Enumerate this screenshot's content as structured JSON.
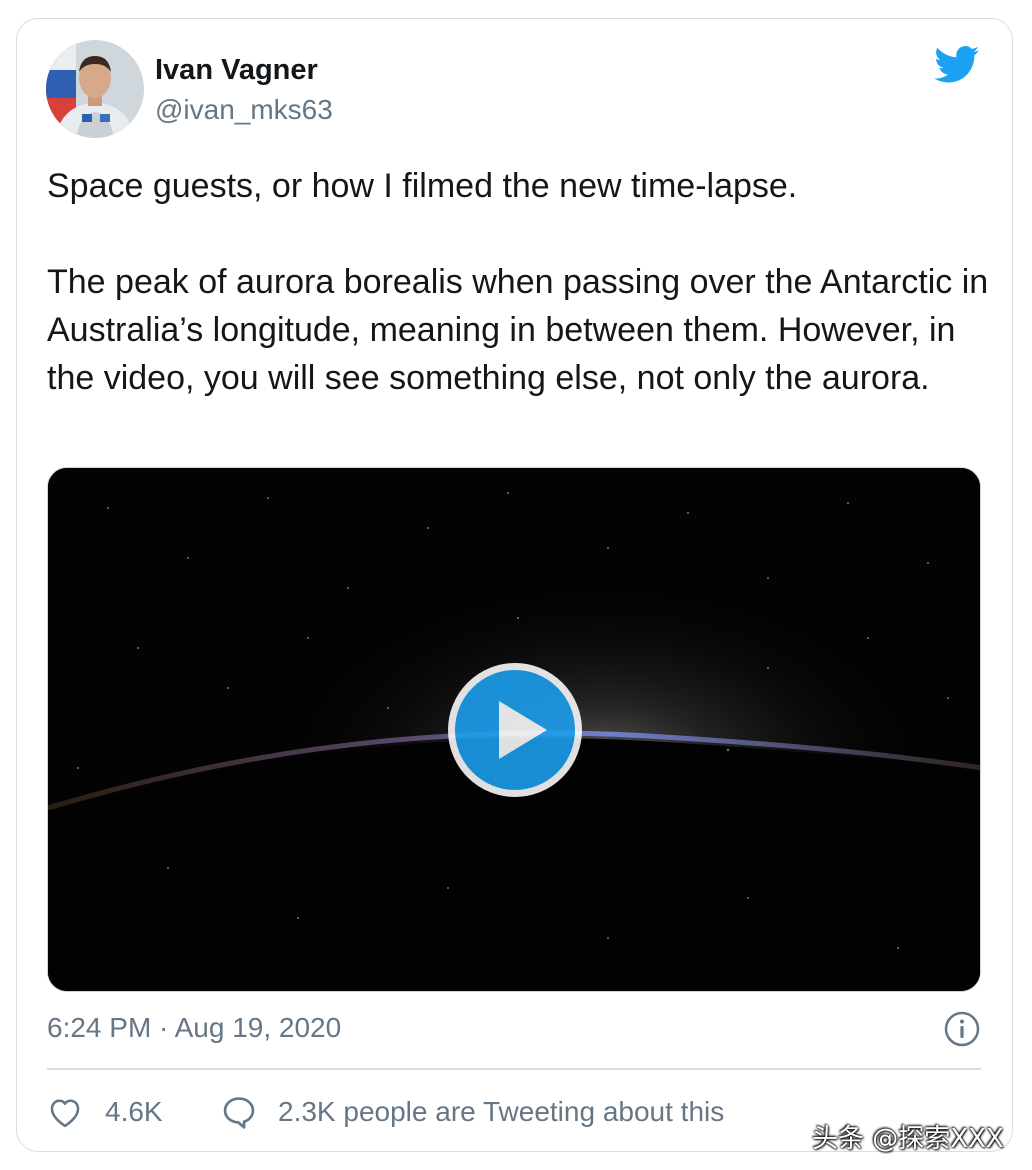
{
  "tweet": {
    "author": {
      "name": "Ivan Vagner",
      "handle": "@ivan_mks63"
    },
    "text": "Space guests, or how I filmed the new time-lapse.\n\nThe peak of aurora borealis when passing over the Antarctic in Australia’s longitude, meaning in between them. However, in the video, you will see something else, not only the aurora.",
    "timestamp": "6:24 PM · Aug 19, 2020",
    "likes": "4.6K",
    "tweeting_about": "2.3K people are Tweeting about this"
  },
  "icons": {
    "brand": "twitter-bird-icon",
    "info": "info-icon",
    "like": "heart-icon",
    "reply": "speech-bubble-icon",
    "play": "play-icon"
  },
  "colors": {
    "brand": "#1da1f2",
    "text_primary": "#14171a",
    "text_secondary": "#657786",
    "border": "#d9dde1"
  },
  "watermark": "头条 @探索XXX"
}
